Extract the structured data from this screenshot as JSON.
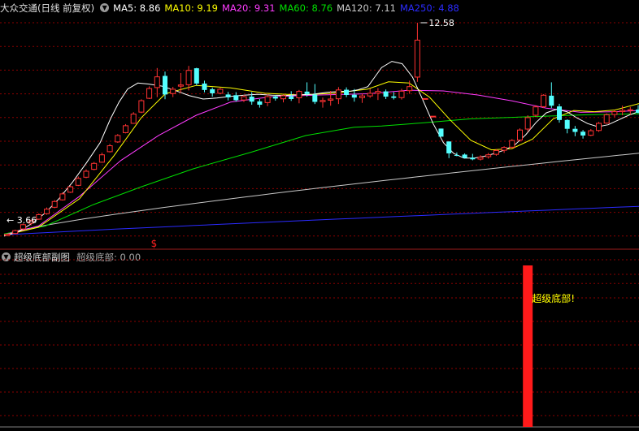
{
  "main_header": {
    "title": "大众交通(日线 前复权)",
    "ma_labels": [
      {
        "label": "MA5: 8.86",
        "color": "#ffffff"
      },
      {
        "label": "MA10: 9.19",
        "color": "#ffff00"
      },
      {
        "label": "MA20: 9.31",
        "color": "#ff3cff"
      },
      {
        "label": "MA60: 8.76",
        "color": "#00e000"
      },
      {
        "label": "MA120: 7.11",
        "color": "#c8c8c8"
      },
      {
        "label": "MA250: 4.88",
        "color": "#2b2bff"
      }
    ]
  },
  "sub_header": {
    "title": "超级底部副图",
    "value_label": "超级底部: 0.00"
  },
  "chart_data": [
    {
      "type": "candlestick",
      "annotations": {
        "high_label": "12.58",
        "low_label": "3.66",
        "marker": "$"
      },
      "colors": {
        "up": "#ff3232",
        "down": "#54ffff",
        "grid": "#8b0000"
      },
      "series": [
        {
          "name": "MA5",
          "color": "#ffffff"
        },
        {
          "name": "MA10",
          "color": "#ffff00"
        },
        {
          "name": "MA20",
          "color": "#ff3cff"
        },
        {
          "name": "MA60",
          "color": "#00e000"
        },
        {
          "name": "MA120",
          "color": "#c8c8c8"
        },
        {
          "name": "MA250",
          "color": "#2b2bff"
        }
      ]
    },
    {
      "type": "bar",
      "series": [
        {
          "name": "超级底部",
          "color": "#ff1a1a"
        }
      ],
      "label": "超级底部!",
      "label_color": "#ffff00",
      "signal_bar_index": 66
    }
  ]
}
